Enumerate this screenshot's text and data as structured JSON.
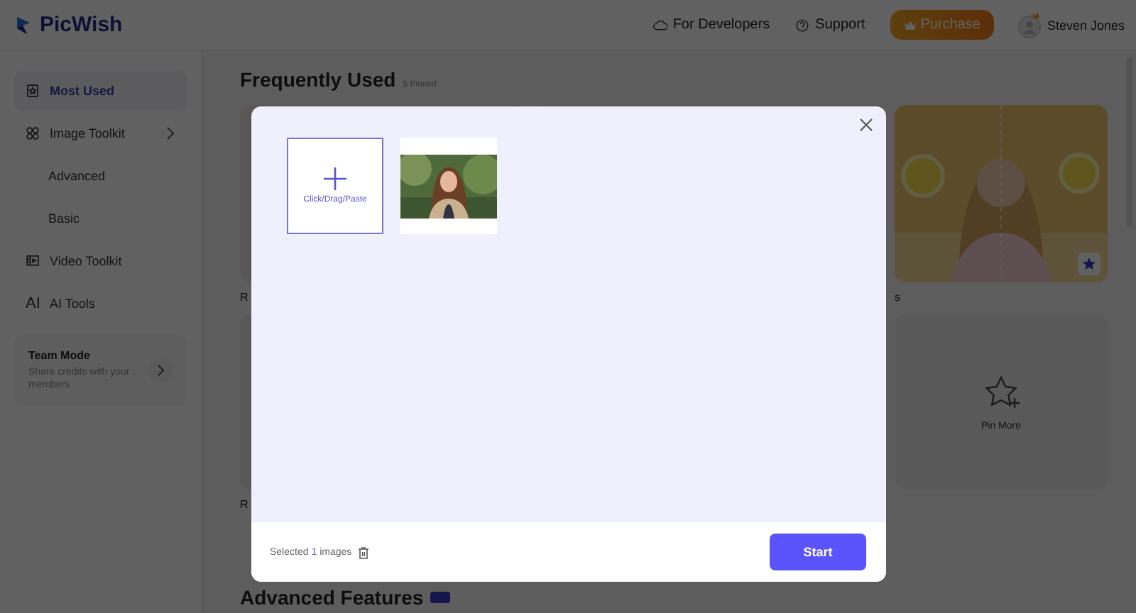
{
  "header": {
    "brand": "PicWish",
    "links": [
      {
        "kind": "developers",
        "label": "For Developers"
      },
      {
        "kind": "support",
        "label": "Support"
      }
    ],
    "purchase": "Purchase",
    "user": "Steven Jones"
  },
  "sidebar": {
    "items": [
      {
        "kind": "star",
        "label": "Most Used",
        "selected": true,
        "sub": false,
        "chevron": false
      },
      {
        "kind": "grid",
        "label": "Image Toolkit",
        "selected": false,
        "sub": false,
        "chevron": true
      },
      {
        "kind": "none",
        "label": "Advanced",
        "selected": false,
        "sub": true,
        "chevron": false
      },
      {
        "kind": "none",
        "label": "Basic",
        "selected": false,
        "sub": true,
        "chevron": false
      },
      {
        "kind": "video",
        "label": "Video Toolkit",
        "selected": false,
        "sub": false,
        "chevron": false
      },
      {
        "kind": "ai",
        "icon_text": "AI",
        "label": "AI Tools",
        "selected": false,
        "sub": false,
        "chevron": false
      }
    ],
    "team": {
      "title": "Team Mode",
      "description": "Share credits with your members"
    }
  },
  "main": {
    "title": "Frequently Used",
    "pinned": "5 Pinned",
    "card_labels": [
      {
        "left": "R",
        "right": "s"
      },
      {
        "left": "R"
      }
    ],
    "pin_more": "Pin More",
    "section_title": "Advanced Features"
  },
  "dialog": {
    "upload_label": "Click/Drag/Paste",
    "footer": {
      "prefix": "Selected",
      "count": "1",
      "suffix": "images"
    },
    "start": "Start"
  }
}
